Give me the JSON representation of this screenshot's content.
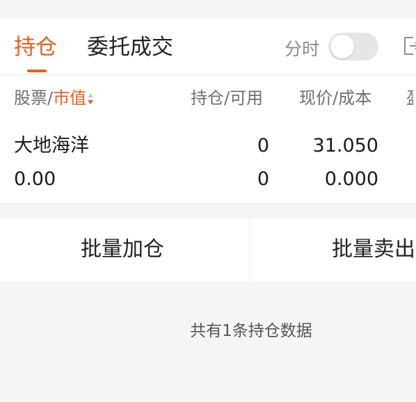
{
  "tabs": [
    {
      "label": "持仓",
      "active": true
    },
    {
      "label": "委托成交",
      "active": false
    }
  ],
  "timeshare_toggle": {
    "label": "分时",
    "on": false
  },
  "columns": {
    "stock": "股票",
    "market_value": "市值",
    "position": "持仓/可用",
    "price": "现价/成本"
  },
  "holdings": [
    {
      "name": "大地海洋",
      "market_value": "0.00",
      "position": "0",
      "available": "0",
      "price": "31.050",
      "cost": "0.000"
    }
  ],
  "actions": {
    "batch_add": "批量加仓",
    "batch_sell": "批量卖出"
  },
  "summary": "共有1条持仓数据",
  "colors": {
    "accent": "#e0611f",
    "background": "#f5f5f6",
    "toggle_off": "#e6e6e6"
  },
  "icons": [
    "sort-icon",
    "export-icon"
  ]
}
